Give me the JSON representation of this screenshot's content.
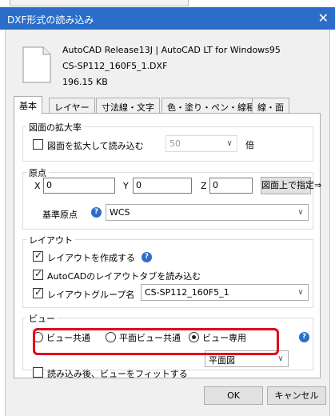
{
  "dialog": {
    "title": "DXF形式の読み込み",
    "close_glyph": "✕"
  },
  "file": {
    "app": "AutoCAD Release13J | AutoCAD LT for Windows95",
    "name": "CS-SP112_160F5_1.DXF",
    "size": "196.15 KB",
    "icon": "document-icon"
  },
  "tabs": [
    "基本",
    "レイヤー",
    "寸法線・文字",
    "色・塗り・ペン・線種",
    "線・面"
  ],
  "zoom": {
    "legend": "図面の拡大率",
    "checkbox_label": "図面を拡大して読み込む",
    "value": "50",
    "unit": "倍",
    "checked": false
  },
  "origin": {
    "legend": "原点",
    "x_label": "X",
    "x_value": "0",
    "y_label": "Y",
    "y_value": "0",
    "z_label": "Z",
    "z_value": "0",
    "pick_button": "図面上で指定⇒",
    "base_label": "基準原点",
    "base_value": "WCS"
  },
  "layout": {
    "legend": "レイアウト",
    "create_label": "レイアウトを作成する",
    "read_tabs_label": "AutoCADのレイアウトタブを読み込む",
    "group_name_label": "レイアウトグループ名",
    "group_name_value": "CS-SP112_160F5_1"
  },
  "view": {
    "legend": "ビュー",
    "options": [
      "ビュー共通",
      "平面ビュー共通",
      "ビュー専用"
    ],
    "selected": 2,
    "plan_value": "平面図",
    "fit_label": "読み込み後、ビューをフィットする"
  },
  "buttons": {
    "ok": "OK",
    "cancel": "キャンセル"
  },
  "colors": {
    "title_bar": "#2b6ec9",
    "highlight": "#e3001b",
    "help": "#2b6ec9"
  }
}
